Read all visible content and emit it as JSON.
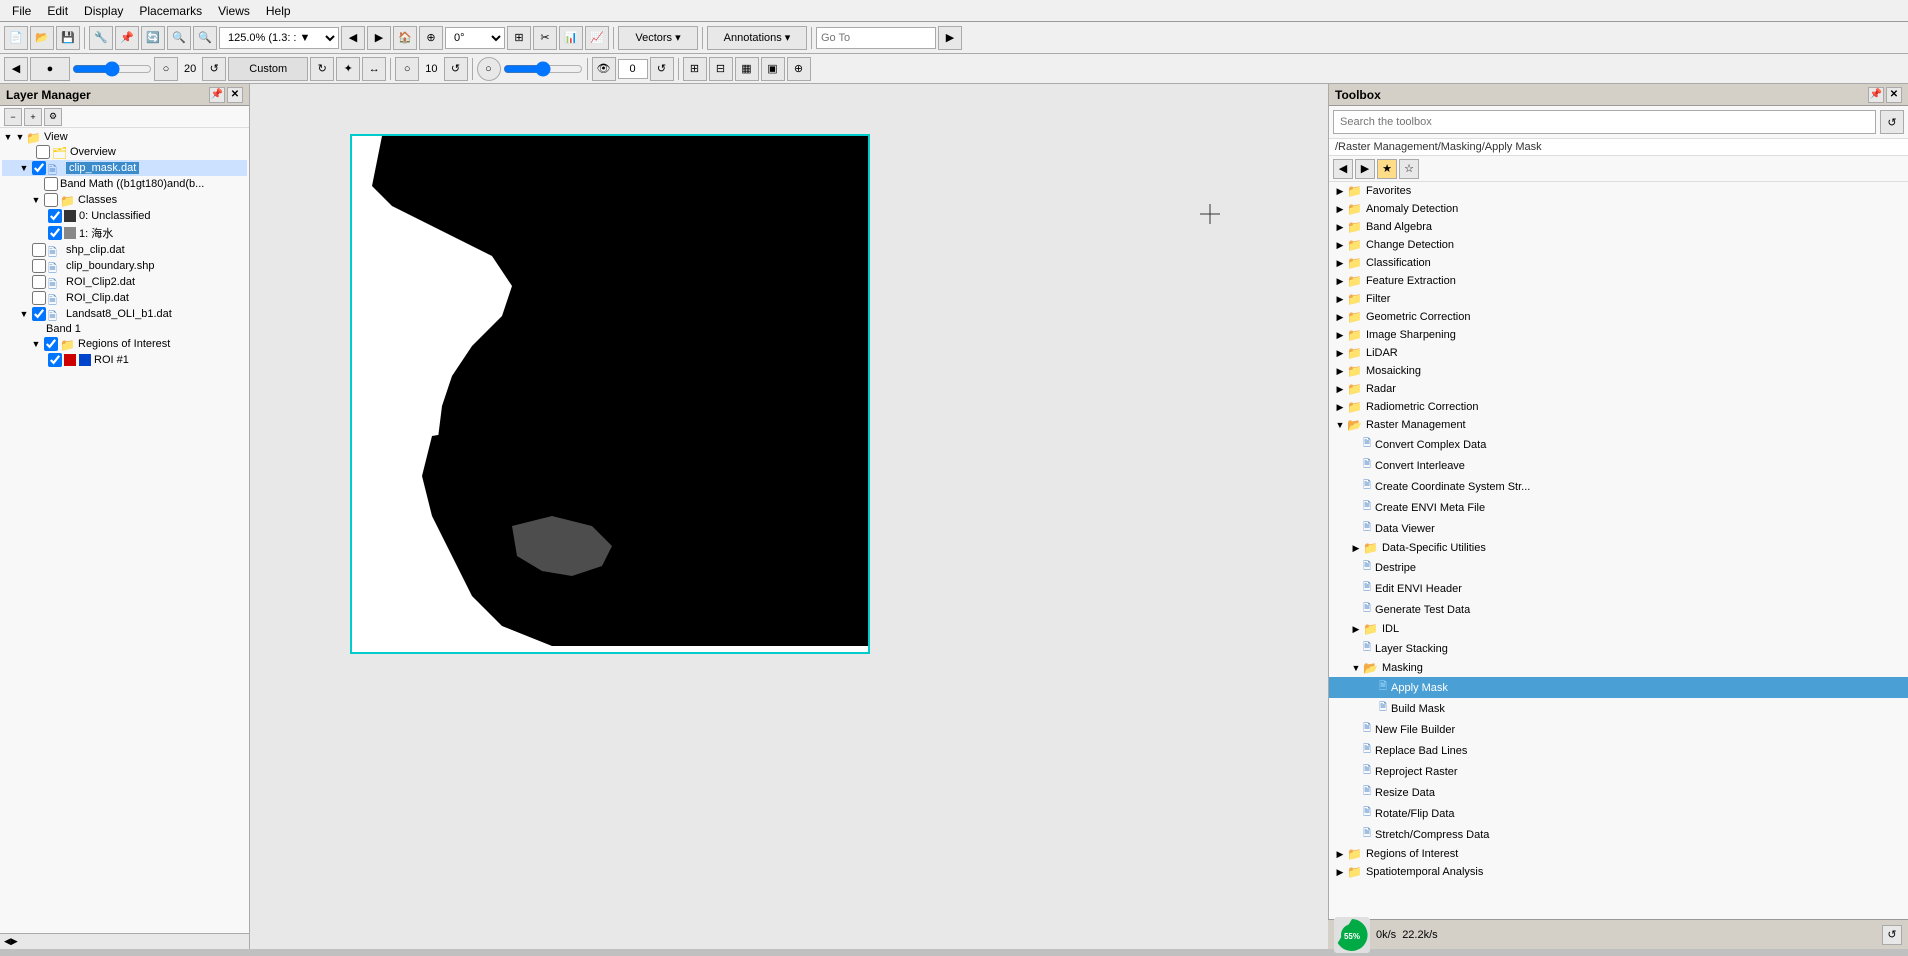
{
  "menubar": {
    "items": [
      "File",
      "Edit",
      "Display",
      "Placemarks",
      "Views",
      "Help"
    ]
  },
  "toolbar1": {
    "zoom_value": "125.0% (1.3: : ▼",
    "angle_value": "0°",
    "vectors_btn": "Vectors ▾",
    "annotations_btn": "Annotations ▾",
    "goto_placeholder": "Go To",
    "custom_value": "Custom"
  },
  "toolbar2": {
    "num1": "20",
    "num2": "10",
    "num3": "0"
  },
  "layer_manager": {
    "title": "Layer Manager",
    "view_label": "View",
    "items": [
      {
        "label": "Overview",
        "type": "item",
        "indent": 1,
        "checked": false
      },
      {
        "label": "clip_mask.dat",
        "type": "file",
        "indent": 1,
        "checked": true,
        "selected": true
      },
      {
        "label": "Band Math ((b1gt180)and(b...",
        "type": "item",
        "indent": 2,
        "checked": false
      },
      {
        "label": "Classes",
        "type": "folder",
        "indent": 2,
        "checked": false
      },
      {
        "label": "0: Unclassified",
        "type": "item",
        "indent": 3,
        "checked": true
      },
      {
        "label": "1: 海水",
        "type": "item",
        "indent": 3,
        "checked": true
      },
      {
        "label": "shp_clip.dat",
        "type": "file",
        "indent": 1,
        "checked": false
      },
      {
        "label": "clip_boundary.shp",
        "type": "file",
        "indent": 1,
        "checked": false
      },
      {
        "label": "ROI_Clip2.dat",
        "type": "file",
        "indent": 1,
        "checked": false
      },
      {
        "label": "ROI_Clip.dat",
        "type": "file",
        "indent": 1,
        "checked": false
      },
      {
        "label": "Landsat8_OLI_b1.dat",
        "type": "file",
        "indent": 1,
        "checked": true
      },
      {
        "label": "Band 1",
        "type": "item",
        "indent": 2,
        "checked": false
      },
      {
        "label": "Regions of Interest",
        "type": "folder",
        "indent": 2,
        "checked": true
      },
      {
        "label": "ROI #1",
        "type": "roi",
        "indent": 3,
        "checked": true
      }
    ]
  },
  "toolbox": {
    "title": "Toolbox",
    "search_placeholder": "Search the toolbox",
    "current_path": "/Raster Management/Masking/Apply Mask",
    "categories": [
      {
        "label": "Favorites",
        "type": "folder",
        "indent": 0,
        "expanded": false
      },
      {
        "label": "Anomaly Detection",
        "type": "folder",
        "indent": 0,
        "expanded": false
      },
      {
        "label": "Band Algebra",
        "type": "folder",
        "indent": 0,
        "expanded": false
      },
      {
        "label": "Change Detection",
        "type": "folder",
        "indent": 0,
        "expanded": false
      },
      {
        "label": "Classification",
        "type": "folder",
        "indent": 0,
        "expanded": false
      },
      {
        "label": "Feature Extraction",
        "type": "folder",
        "indent": 0,
        "expanded": false
      },
      {
        "label": "Filter",
        "type": "folder",
        "indent": 0,
        "expanded": false
      },
      {
        "label": "Geometric Correction",
        "type": "folder",
        "indent": 0,
        "expanded": false
      },
      {
        "label": "Image Sharpening",
        "type": "folder",
        "indent": 0,
        "expanded": false
      },
      {
        "label": "LiDAR",
        "type": "folder",
        "indent": 0,
        "expanded": false
      },
      {
        "label": "Mosaicking",
        "type": "folder",
        "indent": 0,
        "expanded": false
      },
      {
        "label": "Radar",
        "type": "folder",
        "indent": 0,
        "expanded": false
      },
      {
        "label": "Radiometric Correction",
        "type": "folder",
        "indent": 0,
        "expanded": false
      },
      {
        "label": "Raster Management",
        "type": "folder",
        "indent": 0,
        "expanded": true
      },
      {
        "label": "Convert Complex Data",
        "type": "file",
        "indent": 1,
        "expanded": false
      },
      {
        "label": "Convert Interleave",
        "type": "file",
        "indent": 1,
        "expanded": false
      },
      {
        "label": "Create Coordinate System Str...",
        "type": "file",
        "indent": 1,
        "expanded": false
      },
      {
        "label": "Create ENVI Meta File",
        "type": "file",
        "indent": 1,
        "expanded": false
      },
      {
        "label": "Data Viewer",
        "type": "file",
        "indent": 1,
        "expanded": false
      },
      {
        "label": "Data-Specific Utilities",
        "type": "folder",
        "indent": 1,
        "expanded": false
      },
      {
        "label": "Destripe",
        "type": "file",
        "indent": 1,
        "expanded": false
      },
      {
        "label": "Edit ENVI Header",
        "type": "file",
        "indent": 1,
        "expanded": false
      },
      {
        "label": "Generate Test Data",
        "type": "file",
        "indent": 1,
        "expanded": false
      },
      {
        "label": "IDL",
        "type": "folder",
        "indent": 1,
        "expanded": false
      },
      {
        "label": "Layer Stacking",
        "type": "file",
        "indent": 1,
        "expanded": false
      },
      {
        "label": "Masking",
        "type": "folder",
        "indent": 1,
        "expanded": true
      },
      {
        "label": "Apply Mask",
        "type": "file",
        "indent": 2,
        "expanded": false,
        "selected": true
      },
      {
        "label": "Build Mask",
        "type": "file",
        "indent": 2,
        "expanded": false
      },
      {
        "label": "New File Builder",
        "type": "file",
        "indent": 1,
        "expanded": false
      },
      {
        "label": "Replace Bad Lines",
        "type": "file",
        "indent": 1,
        "expanded": false
      },
      {
        "label": "Reproject Raster",
        "type": "file",
        "indent": 1,
        "expanded": false
      },
      {
        "label": "Resize Data",
        "type": "file",
        "indent": 1,
        "expanded": false
      },
      {
        "label": "Rotate/Flip Data",
        "type": "file",
        "indent": 1,
        "expanded": false
      },
      {
        "label": "Stretch/Compress Data",
        "type": "file",
        "indent": 1,
        "expanded": false
      },
      {
        "label": "Regions of Interest",
        "type": "folder",
        "indent": 0,
        "expanded": false
      },
      {
        "label": "Spatiotemporal Analysis",
        "type": "folder",
        "indent": 0,
        "expanded": false
      }
    ]
  },
  "status": {
    "progress_pct": "55%",
    "speed1": "0k/s",
    "speed2": "22.2k/s"
  },
  "colors": {
    "accent_blue": "#0078d7",
    "selected_bg": "#4a9fd4",
    "apply_mask_bg": "#4a9fd4",
    "folder_yellow": "#ffcc00"
  }
}
